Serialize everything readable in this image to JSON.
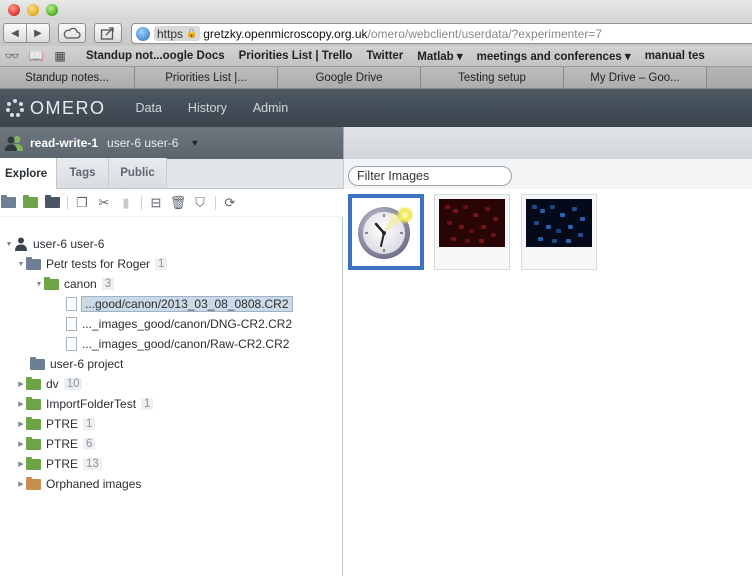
{
  "browser": {
    "url_scheme": "https",
    "url_host": "gretzky.openmicroscopy.org.uk",
    "url_path": "/omero/webclient/userdata/?experimenter=7",
    "bookmarks": [
      "Standup not...oogle Docs",
      "Priorities List | Trello",
      "Twitter",
      "Matlab ▾",
      "meetings and conferences ▾",
      "manual tes"
    ],
    "tabs": [
      "Standup notes...",
      "Priorities List |...",
      "Google Drive",
      "Testing setup",
      "My Drive – Goo..."
    ]
  },
  "header": {
    "logo": "OMERO",
    "nav": [
      "Data",
      "History",
      "Admin"
    ]
  },
  "group": {
    "name": "read-write-1",
    "user": "user-6 user-6"
  },
  "left_tabs": [
    "Explore",
    "Tags",
    "Public"
  ],
  "tree": {
    "root": "user-6 user-6",
    "project": {
      "name": "Petr tests for Roger",
      "count": "1"
    },
    "dataset": {
      "name": "canon",
      "count": "3"
    },
    "images": [
      "...good/canon/2013_03_08_0808.CR2",
      "..._images_good/canon/DNG-CR2.CR2",
      "..._images_good/canon/Raw-CR2.CR2"
    ],
    "project2": {
      "name": "user-6 project"
    },
    "datasets": [
      {
        "name": "dv",
        "count": "10"
      },
      {
        "name": "ImportFolderTest",
        "count": "1"
      },
      {
        "name": "PTRE",
        "count": "1"
      },
      {
        "name": "PTRE",
        "count": "6"
      },
      {
        "name": "PTRE",
        "count": "13"
      }
    ],
    "orphaned": "Orphaned images"
  },
  "right": {
    "filter_placeholder": "Filter Images"
  },
  "colors": {
    "header_bg": "#3a444d",
    "accent_selected": "#3b72c4",
    "folder_green": "#6fa347",
    "folder_blue": "#6e7f94",
    "folder_orange": "#c78d4f"
  }
}
